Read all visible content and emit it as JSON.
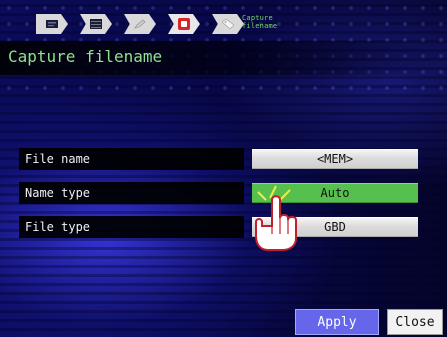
{
  "header": {
    "tab_title": "Capture filename",
    "page_title": "Capture filename",
    "tabs": [
      {
        "icon": "keyboard-icon"
      },
      {
        "icon": "list-icon"
      },
      {
        "icon": "pen-icon"
      },
      {
        "icon": "record-icon"
      },
      {
        "icon": "tag-icon"
      }
    ]
  },
  "settings": {
    "rows": [
      {
        "label": "File name",
        "value": "<MEM>"
      },
      {
        "label": "Name type",
        "value": "Auto"
      },
      {
        "label": "File type",
        "value": "GBD"
      }
    ]
  },
  "footer": {
    "apply_label": "Apply",
    "close_label": "Close"
  },
  "colors": {
    "selected_value": "#55c04e",
    "apply_button": "#6566ea",
    "title_text": "#8fe28f"
  }
}
